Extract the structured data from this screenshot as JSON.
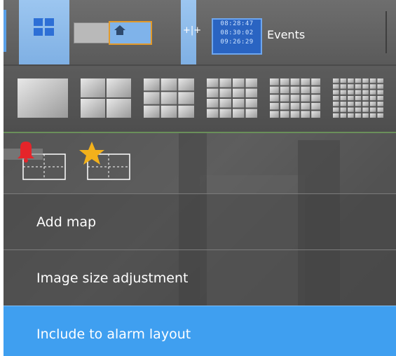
{
  "toolbar": {
    "events_times": [
      "08:28:47",
      "08:30:02",
      "09:26:29"
    ],
    "events_label": "Events",
    "split_glyph": "+|+"
  },
  "layouts": [
    "1x1",
    "2x2",
    "3x3",
    "4x4",
    "5x5",
    "7x7"
  ],
  "icons": [
    "alarm-bell-layout-icon",
    "favorite-star-layout-icon"
  ],
  "menu": {
    "items": [
      {
        "label": "Add map"
      },
      {
        "label": "Image size adjustment"
      },
      {
        "label": "Include to alarm layout"
      }
    ]
  },
  "colors": {
    "accent": "#3f9ff0",
    "toolbar_active": "#8cbcef",
    "bell": "#e5242a",
    "star": "#f3b11b"
  }
}
